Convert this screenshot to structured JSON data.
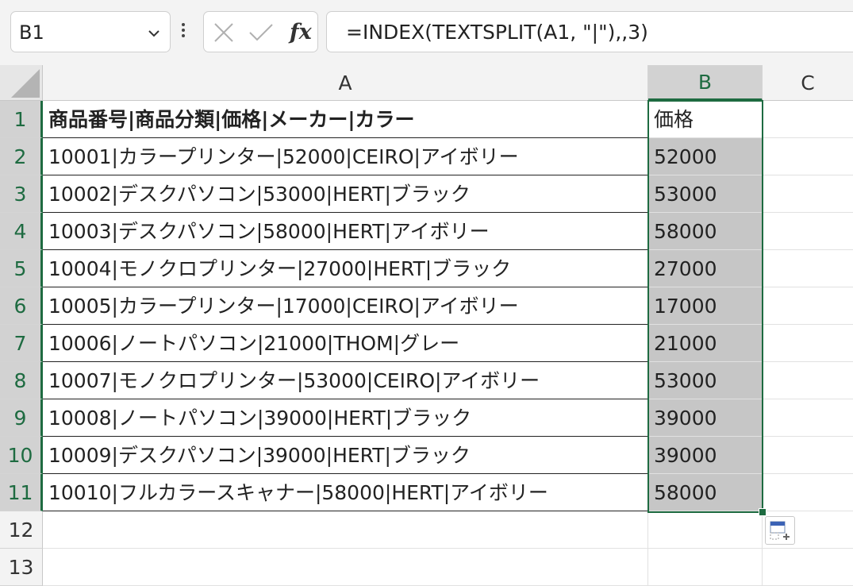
{
  "formula_bar": {
    "name_box": "B1",
    "fx_label": "fx",
    "formula": "=INDEX(TEXTSPLIT(A1, \"|\"),,3)"
  },
  "columns": [
    "A",
    "B",
    "C"
  ],
  "rows": [
    "1",
    "2",
    "3",
    "4",
    "5",
    "6",
    "7",
    "8",
    "9",
    "10",
    "11",
    "12",
    "13"
  ],
  "colA": [
    "商品番号|商品分類|価格|メーカー|カラー",
    "10001|カラープリンター|52000|CEIRO|アイボリー",
    "10002|デスクパソコン|53000|HERT|ブラック",
    "10003|デスクパソコン|58000|HERT|アイボリー",
    "10004|モノクロプリンター|27000|HERT|ブラック",
    "10005|カラープリンター|17000|CEIRO|アイボリー",
    "10006|ノートパソコン|21000|THOM|グレー",
    "10007|モノクロプリンター|53000|CEIRO|アイボリー",
    "10008|ノートパソコン|39000|HERT|ブラック",
    "10009|デスクパソコン|39000|HERT|ブラック",
    "10010|フルカラースキャナー|58000|HERT|アイボリー"
  ],
  "colB": [
    "価格",
    "52000",
    "53000",
    "58000",
    "27000",
    "17000",
    "21000",
    "53000",
    "39000",
    "39000",
    "58000"
  ],
  "colors": {
    "accent": "#1e6b41",
    "selection_fill": "#c6c6c6"
  }
}
